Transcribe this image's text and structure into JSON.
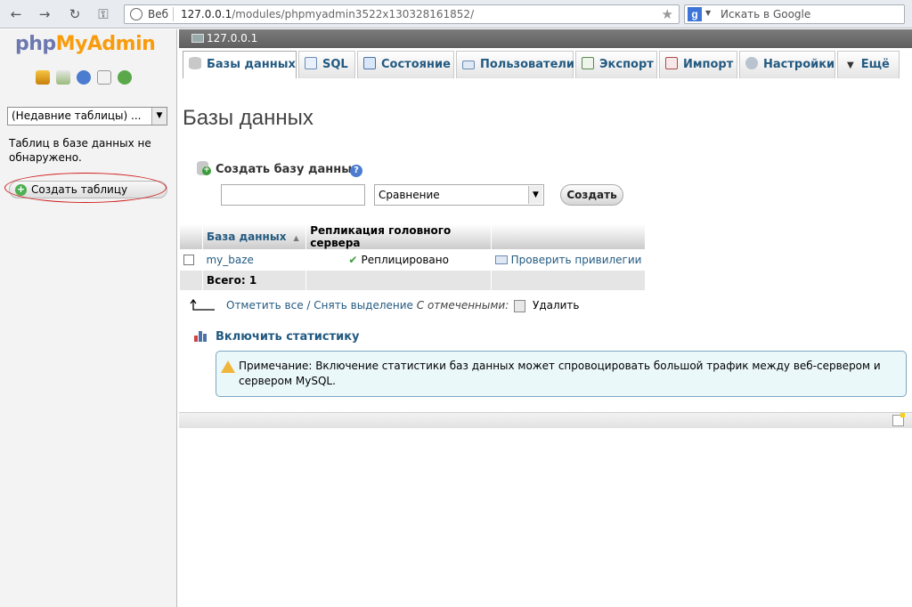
{
  "browser": {
    "back": "←",
    "forward": "→",
    "reload": "↻",
    "key": "⚿",
    "protocol_label": "Веб",
    "url_host": "127.0.0.1",
    "url_path": "/modules/phpmyadmin3522x130328161852/",
    "search_placeholder": "Искать в Google",
    "star": "★"
  },
  "sidebar": {
    "logo_php": "php",
    "logo_my": "My",
    "logo_admin": "Admin",
    "recent_tables": "(Недавние таблицы) ...",
    "no_tables_text": "Таблиц в базе данных не обнаружено.",
    "create_table_label": "Создать таблицу"
  },
  "server": {
    "name": "127.0.0.1"
  },
  "tabs": [
    {
      "label": "Базы данных",
      "icon": "database-icon",
      "active": true
    },
    {
      "label": "SQL",
      "icon": "sql-icon"
    },
    {
      "label": "Состояние",
      "icon": "status-icon"
    },
    {
      "label": "Пользователи",
      "icon": "users-icon"
    },
    {
      "label": "Экспорт",
      "icon": "export-icon"
    },
    {
      "label": "Импорт",
      "icon": "import-icon"
    },
    {
      "label": "Настройки",
      "icon": "settings-icon"
    },
    {
      "label": "Ещё",
      "icon": "more-icon"
    }
  ],
  "main": {
    "title": "Базы данных",
    "create_db_label": "Создать базу данных",
    "db_name_value": "",
    "collation_value": "Сравнение",
    "create_button": "Создать",
    "table": {
      "headers": [
        "База данных",
        "Репликация головного сервера"
      ],
      "rows": [
        {
          "name": "my_baze",
          "replication": "Реплицировано",
          "action": "Проверить привилегии"
        }
      ],
      "total_label": "Всего: 1"
    },
    "select_all": "Отметить все",
    "separator": "/",
    "deselect_all": "Снять выделение",
    "with_selected": "С отмеченными:",
    "delete_label": "Удалить",
    "enable_stats": "Включить статистику",
    "notice": "Примечание: Включение статистики баз данных может спровоцировать большой трафик между веб-сервером и сервером MySQL."
  },
  "colors": {
    "link": "#235a81",
    "logo_php": "#6c78af",
    "logo_admin": "#f89c0e",
    "notice_bg": "#ebf8fa",
    "highlight_oval": "#d01b1b"
  }
}
